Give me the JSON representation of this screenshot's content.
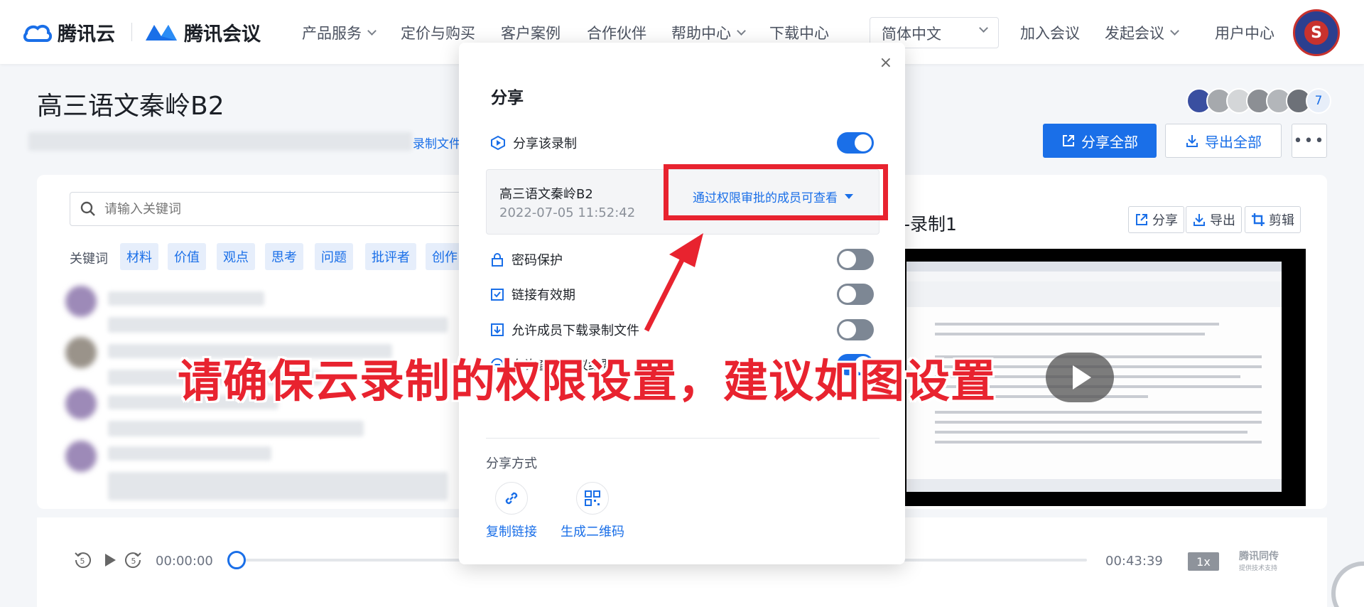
{
  "header": {
    "brand1": "腾讯云",
    "brand2": "腾讯会议",
    "nav": [
      {
        "label": "产品服务",
        "dropdown": true
      },
      {
        "label": "定价与购买",
        "dropdown": false
      },
      {
        "label": "客户案例",
        "dropdown": false
      },
      {
        "label": "合作伙伴",
        "dropdown": false
      },
      {
        "label": "帮助中心",
        "dropdown": true
      },
      {
        "label": "下载中心",
        "dropdown": false
      }
    ],
    "language": "简体中文",
    "join_meeting": "加入会议",
    "start_meeting": "发起会议",
    "user_center": "用户中心",
    "avatar_letter": "S"
  },
  "page": {
    "title": "高三语文秦岭B2",
    "record_link": "录制文件",
    "participant_count": "7",
    "share_all": "分享全部",
    "export_all": "导出全部",
    "more": "•••"
  },
  "transcript": {
    "search_placeholder": "请输入关键词",
    "keyword_label": "关键词",
    "keywords": [
      "材料",
      "价值",
      "观点",
      "思考",
      "问题",
      "批评者",
      "创作"
    ]
  },
  "recording": {
    "title": "-录制1",
    "share": "分享",
    "export": "导出",
    "edit": "剪辑"
  },
  "player": {
    "current_time": "00:00:00",
    "total_time": "00:43:39",
    "speed": "1x",
    "provider": "腾讯同传",
    "provider_sub": "提供技术支持",
    "rewind_seconds": "5",
    "forward_seconds": "5",
    "progress": 0
  },
  "modal": {
    "close": "×",
    "title": "分享",
    "share_recording": "分享该录制",
    "share_recording_on": true,
    "record_name": "高三语文秦岭B2",
    "record_date": "2022-07-05 11:52:42",
    "permission": "通过权限审批的成员可查看",
    "password": "密码保护",
    "password_on": false,
    "link_expiry": "链接有效期",
    "link_expiry_on": false,
    "allow_download": "允许成员下载录制文件",
    "allow_download_on": false,
    "allow_view_minutes": "允许查看会议纪要",
    "allow_view_minutes_on": true,
    "share_method": "分享方式",
    "copy_link": "复制链接",
    "qr_code": "生成二维码"
  },
  "annotation": {
    "text": "请确保云录制的权限设置，建议如图设置",
    "color": "#e8232f"
  }
}
